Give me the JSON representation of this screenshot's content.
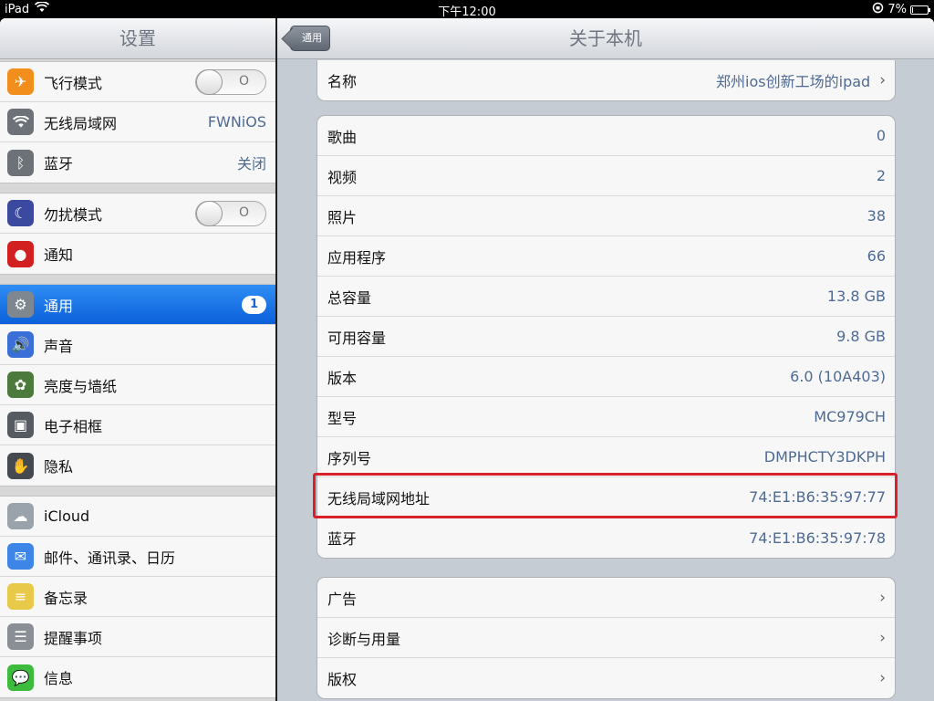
{
  "status": {
    "device": "iPad",
    "time": "下午12:00",
    "battery": "7%",
    "battery_level": 0.07
  },
  "left": {
    "title": "设置",
    "groups": [
      [
        {
          "name": "airplane",
          "icon": "airplane-icon",
          "color": "#f28e1c",
          "label": "飞行模式",
          "toggle": "O"
        },
        {
          "name": "wifi",
          "icon": "wifi-icon",
          "color": "#6d7278",
          "label": "无线局域网",
          "value": "FWNiOS"
        },
        {
          "name": "bluetooth",
          "icon": "bluetooth-icon",
          "color": "#6d7278",
          "label": "蓝牙",
          "value": "关闭"
        }
      ],
      [
        {
          "name": "dnd",
          "icon": "moon-icon",
          "color": "#3b4a9e",
          "label": "勿扰模式",
          "toggle": "O"
        },
        {
          "name": "notifications",
          "icon": "notification-icon",
          "color": "#d21f1f",
          "label": "通知"
        }
      ],
      [
        {
          "name": "general",
          "icon": "gear-icon",
          "color": "#7e8790",
          "label": "通用",
          "badge": "1",
          "selected": true
        },
        {
          "name": "sounds",
          "icon": "speaker-icon",
          "color": "#3a6fd8",
          "label": "声音"
        },
        {
          "name": "brightness",
          "icon": "flower-icon",
          "color": "#4b7a3c",
          "label": "亮度与墙纸"
        },
        {
          "name": "picture-frame",
          "icon": "picture-frame-icon",
          "color": "#555b60",
          "label": "电子相框"
        },
        {
          "name": "privacy",
          "icon": "hand-icon",
          "color": "#454a50",
          "label": "隐私"
        }
      ],
      [
        {
          "name": "icloud",
          "icon": "cloud-icon",
          "color": "#9aa3ab",
          "label": "iCloud"
        },
        {
          "name": "mail",
          "icon": "mail-icon",
          "color": "#3d86e8",
          "label": "邮件、通讯录、日历"
        },
        {
          "name": "notes",
          "icon": "notes-icon",
          "color": "#e8c94a",
          "label": "备忘录"
        },
        {
          "name": "reminders",
          "icon": "reminders-icon",
          "color": "#8a8f95",
          "label": "提醒事项"
        },
        {
          "name": "messages",
          "icon": "message-icon",
          "color": "#3dbb3d",
          "label": "信息"
        }
      ]
    ]
  },
  "right": {
    "back_label": "通用",
    "title": "关于本机",
    "groups": [
      [
        {
          "label": "名称",
          "value": "郑州ios创新工场的ipad",
          "chevron": true
        }
      ],
      [
        {
          "label": "歌曲",
          "value": "0"
        },
        {
          "label": "视频",
          "value": "2"
        },
        {
          "label": "照片",
          "value": "38"
        },
        {
          "label": "应用程序",
          "value": "66"
        },
        {
          "label": "总容量",
          "value": "13.8 GB"
        },
        {
          "label": "可用容量",
          "value": "9.8 GB"
        },
        {
          "label": "版本",
          "value": "6.0 (10A403)"
        },
        {
          "label": "型号",
          "value": "MC979CH"
        },
        {
          "label": "序列号",
          "value": "DMPHCTY3DKPH"
        },
        {
          "label": "无线局域网地址",
          "value": "74:E1:B6:35:97:77",
          "highlight": true
        },
        {
          "label": "蓝牙",
          "value": "74:E1:B6:35:97:78"
        }
      ],
      [
        {
          "label": "广告",
          "chevron": true
        },
        {
          "label": "诊断与用量",
          "chevron": true
        },
        {
          "label": "版权",
          "chevron": true
        }
      ]
    ],
    "highlight_color": "#d8222b"
  }
}
